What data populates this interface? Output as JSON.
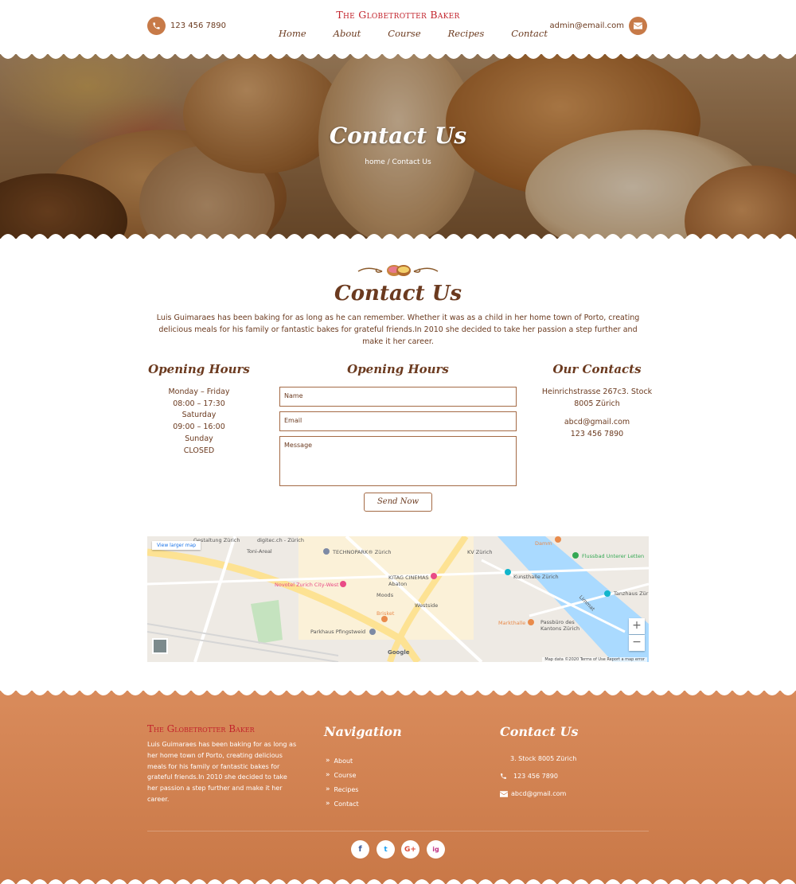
{
  "header": {
    "phone": "123 456 7890",
    "email": "admin@email.com",
    "brand": "The Globetrotter Baker",
    "nav": [
      "Home",
      "About",
      "Course",
      "Recipes",
      "Contact"
    ]
  },
  "hero": {
    "title": "Contact Us",
    "breadcrumb": "home / Contact Us"
  },
  "contact": {
    "title": "Contact Us",
    "intro": "Luis Guimaraes has been baking for as long as he can remember. Whether it was as a child in her home town of Porto, creating delicious meals for his family or fantastic bakes for grateful friends.In 2010 she decided to take her passion a step further and make it her career.",
    "hours": {
      "heading": "Opening Hours",
      "lines": [
        "Monday – Friday",
        "08:00 – 17:30",
        "Saturday",
        "09:00 – 16:00",
        "Sunday",
        "CLOSED"
      ]
    },
    "form": {
      "heading": "Opening Hours",
      "name_placeholder": "Name",
      "email_placeholder": "Email",
      "message_placeholder": "Message",
      "submit": "Send Now"
    },
    "contacts": {
      "heading": "Our Contacts",
      "address_1": "Heinrichstrasse 267c3. Stock",
      "address_2": "8005 Zürich",
      "email": "abcd@gmail.com",
      "phone": "123 456 7890"
    }
  },
  "map": {
    "view_larger": "View larger map",
    "labels": [
      "digitec.ch - Zürich",
      "Toni-Areal",
      "TECHNOPARK® Zürich",
      "Novotel Zurich City-West",
      "KITAG CINEMAS Abaton",
      "Moods",
      "Westside",
      "Brisket",
      "Parkhaus Pfingstweid",
      "KV Zürich",
      "Kunsthalle Zürich",
      "Markthalle",
      "Passbüro des Kantons Zürich",
      "Flussbad Unterer Letten",
      "Tanzhaus Zür",
      "Damm",
      "Limmat",
      "Gestaltung Zürich"
    ],
    "google": "Google",
    "footer": "Map data ©2020   Terms of Use   Report a map error",
    "zoom_in": "+",
    "zoom_out": "−"
  },
  "footer": {
    "brand": "The Globetrotter Baker",
    "about": "Luis Guimaraes has been baking for as long as her home town of Porto, creating delicious meals for his family or fantastic bakes for grateful friends.In 2010 she decided to take her passion a step further and make it her career.",
    "nav_heading": "Navigation",
    "nav_items": [
      "About",
      "Course",
      "Recipes",
      "Contact"
    ],
    "contact_heading": "Contact Us",
    "address": "3. Stock 8005 Zürich",
    "phone": "123 456 7890",
    "email": "abcd@gmail.com",
    "social": [
      "f",
      "t",
      "G+",
      "ig"
    ]
  },
  "colors": {
    "brown": "#6b3a1f",
    "accent": "#c77a48",
    "brand_red": "#c2222b",
    "footer_bg": "#d98b5b"
  }
}
